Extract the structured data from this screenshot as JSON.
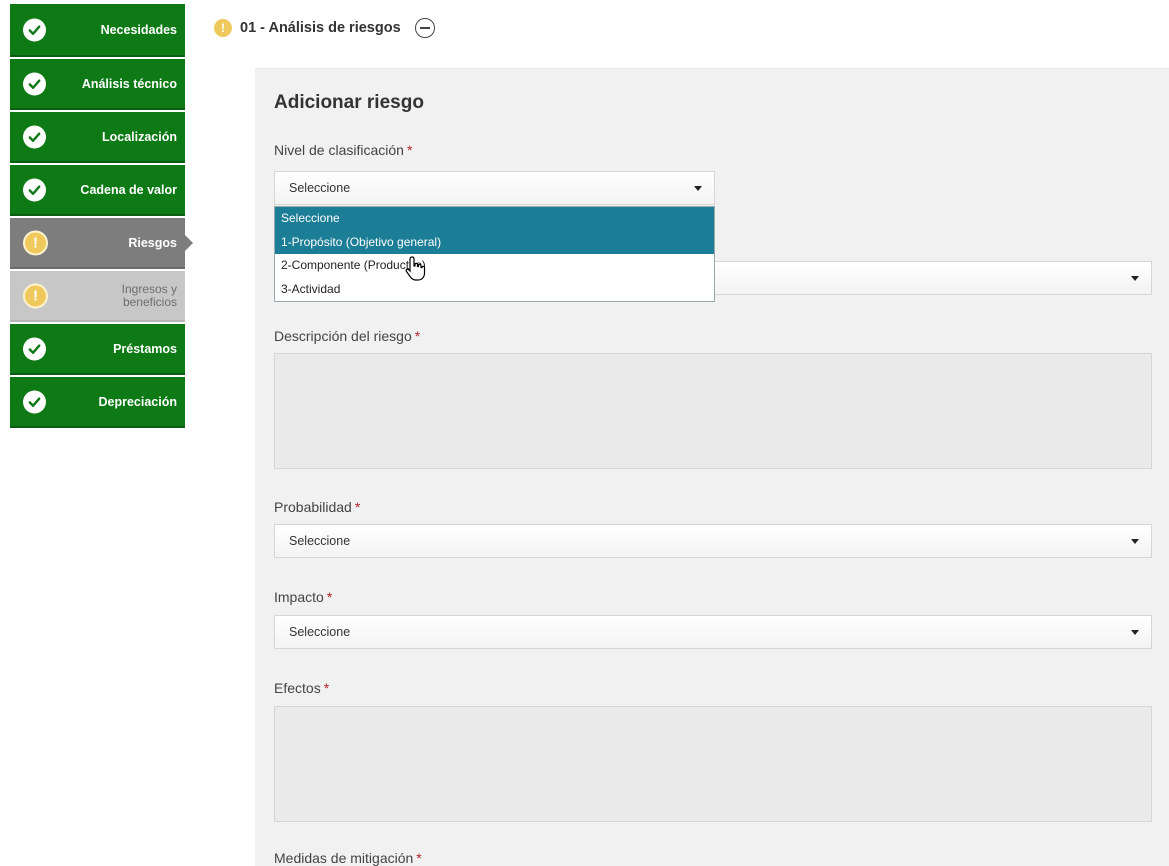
{
  "sidebar": {
    "steps": [
      {
        "label": "Necesidades",
        "status": "complete"
      },
      {
        "label": "Análisis técnico",
        "status": "complete"
      },
      {
        "label": "Localización",
        "status": "complete"
      },
      {
        "label": "Cadena de valor",
        "status": "complete"
      },
      {
        "label": "Riesgos",
        "status": "active-warning"
      },
      {
        "label": "Ingresos y\nbeneficios",
        "status": "disabled-warning"
      },
      {
        "label": "Préstamos",
        "status": "complete"
      },
      {
        "label": "Depreciación",
        "status": "complete"
      }
    ]
  },
  "section": {
    "title": "01 - Análisis de riesgos",
    "warning_icon": "!"
  },
  "form": {
    "title": "Adicionar riesgo",
    "required_mark": "*",
    "nivel": {
      "label": "Nivel de clasificación",
      "value": "Seleccione"
    },
    "nivel_options": [
      "Seleccione",
      "1-Propósito (Objetivo general)",
      "2-Componente (Productos)",
      "3-Actividad"
    ],
    "nivel_highlighted_index": 1,
    "hidden_select": {
      "value": ""
    },
    "descripcion": {
      "label": "Descripción del riesgo"
    },
    "probabilidad": {
      "label": "Probabilidad",
      "value": "Seleccione"
    },
    "impacto": {
      "label": "Impacto",
      "value": "Seleccione"
    },
    "efectos": {
      "label": "Efectos"
    },
    "medidas": {
      "label": "Medidas de mitigación"
    }
  },
  "colors": {
    "step_complete": "#0d7a16",
    "step_active": "#7d7d7d",
    "step_disabled": "#c7c7c7",
    "warning": "#f0c95c",
    "dropdown_highlight": "#1b7d96",
    "required": "#b3242a"
  }
}
